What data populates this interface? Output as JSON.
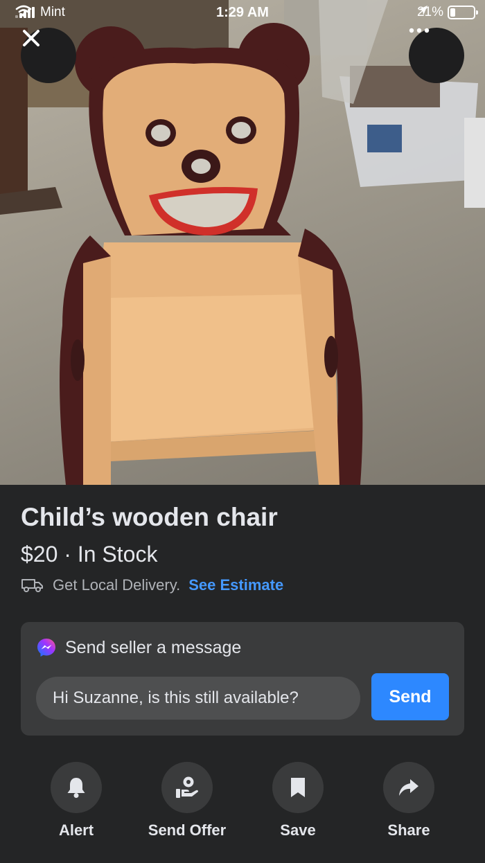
{
  "status_bar": {
    "carrier": "Mint",
    "time": "1:29 AM",
    "battery": "21%",
    "battery_level": 0.21,
    "signal_icon": "signal-bars-icon",
    "wifi_icon": "wifi-icon",
    "location_icon": "location-arrow-icon"
  },
  "top_controls": {
    "close_icon": "close-icon",
    "more_icon": "more-dots-icon"
  },
  "listing": {
    "title": "Child’s wooden chair",
    "price_line": "$20 · In Stock",
    "delivery_text": "Get Local Delivery.",
    "delivery_link": "See Estimate",
    "delivery_icon": "truck-icon"
  },
  "message": {
    "heading": "Send seller a message",
    "heading_icon": "messenger-icon",
    "input_value": "Hi Suzanne, is this still available?",
    "send_label": "Send"
  },
  "actions": [
    {
      "label": "Alert",
      "icon": "bell-icon"
    },
    {
      "label": "Send Offer",
      "icon": "offer-hand-icon"
    },
    {
      "label": "Save",
      "icon": "bookmark-icon"
    },
    {
      "label": "Share",
      "icon": "share-arrow-icon"
    }
  ],
  "colors": {
    "background": "#242526",
    "card": "#3a3b3c",
    "accent": "#2d88ff",
    "link": "#4599ff"
  }
}
